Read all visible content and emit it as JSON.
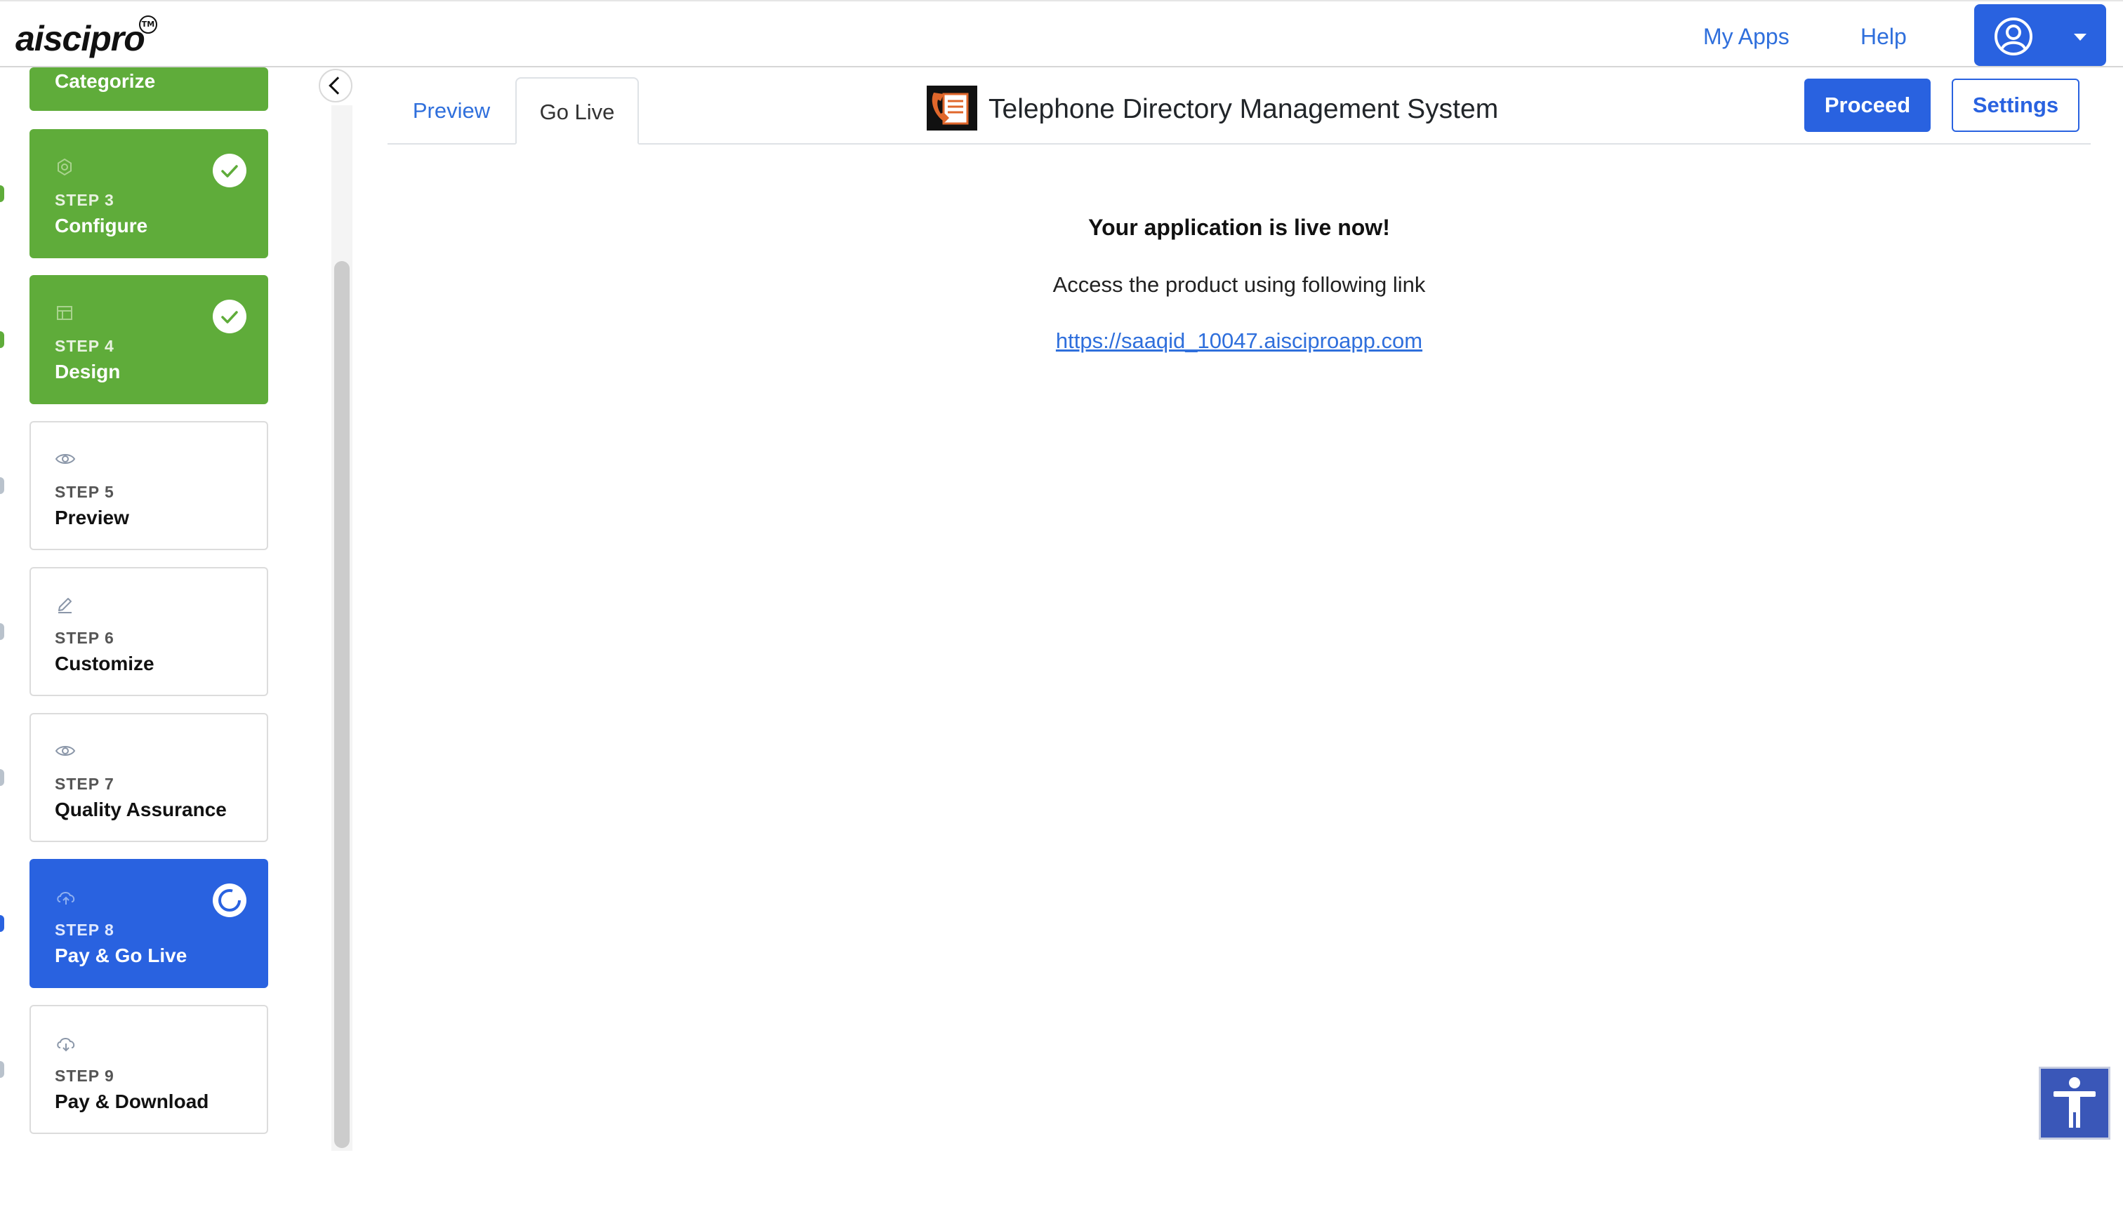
{
  "brand": {
    "name": "aiscipro",
    "tm": "TM"
  },
  "nav": {
    "my_apps": "My Apps",
    "help": "Help"
  },
  "sidebar": {
    "steps": [
      {
        "number": "",
        "title": "Categorize",
        "state": "done"
      },
      {
        "number": "STEP 3",
        "title": "Configure",
        "state": "done",
        "icon": "gear-icon"
      },
      {
        "number": "STEP 4",
        "title": "Design",
        "state": "done",
        "icon": "layout-icon"
      },
      {
        "number": "STEP 5",
        "title": "Preview",
        "state": "pending",
        "icon": "eye-icon"
      },
      {
        "number": "STEP 6",
        "title": "Customize",
        "state": "pending",
        "icon": "pencil-icon"
      },
      {
        "number": "STEP 7",
        "title": "Quality Assurance",
        "state": "pending",
        "icon": "eye-icon"
      },
      {
        "number": "STEP 8",
        "title": "Pay & Go Live",
        "state": "active",
        "icon": "cloud-upload-icon"
      },
      {
        "number": "STEP 9",
        "title": "Pay & Download",
        "state": "pending",
        "icon": "cloud-download-icon"
      }
    ]
  },
  "tabs": {
    "preview": "Preview",
    "go_live": "Go Live",
    "active": "go_live"
  },
  "app": {
    "title": "Telephone Directory Management System"
  },
  "actions": {
    "proceed": "Proceed",
    "settings": "Settings"
  },
  "live": {
    "heading": "Your application is live now!",
    "subtext": "Access the product using following link",
    "link": "https://saaqid_10047.aisciproapp.com"
  },
  "colors": {
    "primary": "#2962e0",
    "done": "#5fac3a",
    "link": "#2f6fdc",
    "accessibility": "#3a57b8"
  }
}
